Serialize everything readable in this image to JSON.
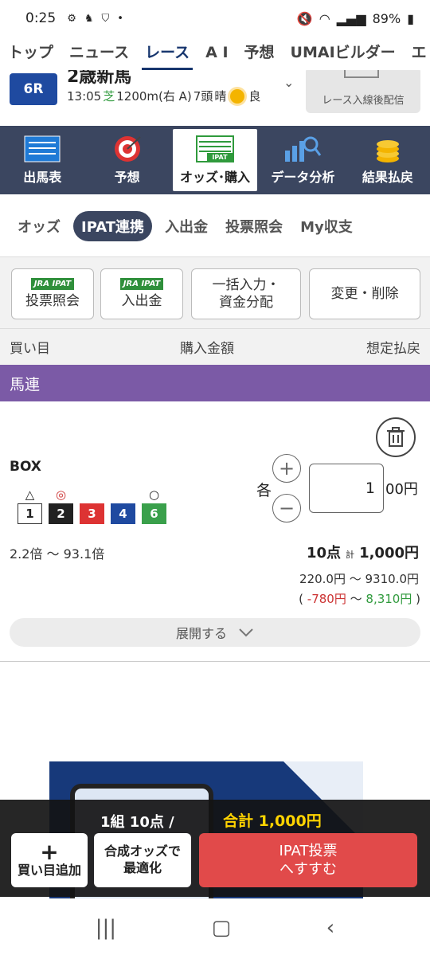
{
  "status": {
    "time": "0:25",
    "battery": "89%"
  },
  "topnav": {
    "items": [
      "トップ",
      "ニュース",
      "レース",
      "A I",
      "予想",
      "UMAIビルダー",
      "エ"
    ],
    "active_index": 2
  },
  "race": {
    "number": "6R",
    "name": "2歳新馬",
    "time": "13:05",
    "surface": "芝",
    "distance": "1200m(右 A)",
    "runners": "7頭",
    "weather": "晴",
    "track": "良",
    "replay_label": "レース入線後配信"
  },
  "menu": {
    "items": [
      {
        "label": "出馬表",
        "icon": "table-icon"
      },
      {
        "label": "予想",
        "icon": "target-icon"
      },
      {
        "label": "オッズ･購入",
        "icon": "ipat-icon"
      },
      {
        "label": "データ分析",
        "icon": "chart-search-icon"
      },
      {
        "label": "結果払戻",
        "icon": "coins-icon"
      }
    ],
    "active_index": 2
  },
  "subtabs": {
    "items": [
      "オッズ",
      "IPAT連携",
      "入出金",
      "投票照会",
      "My収支"
    ],
    "active_index": 1
  },
  "actions": {
    "jra_tag": "JRA IPAT",
    "vote_inquiry": "投票照会",
    "deposit": "入出金",
    "bulk_line1": "一括入力・",
    "bulk_line2": "資金分配",
    "modify": "変更・削除"
  },
  "columns": {
    "bet": "買い目",
    "amount": "購入金額",
    "payout": "想定払戻"
  },
  "bet_type": "馬連",
  "bet": {
    "mode": "BOX",
    "horses": [
      {
        "mark": "△",
        "number": "1"
      },
      {
        "mark": "◎",
        "number": "2"
      },
      {
        "mark": "",
        "number": "3"
      },
      {
        "mark": "",
        "number": "4"
      },
      {
        "mark": "○",
        "number": "6"
      }
    ],
    "each_label": "各",
    "amount_value": "1",
    "amount_suffix": "00円",
    "odds_range": "2.2倍 〜 93.1倍",
    "points": "10点",
    "total_small": "計",
    "total": "1,000円",
    "payout_range": "220.0円 〜 9310.0円",
    "profit_open": "(",
    "profit_min": "-780円",
    "profit_sep": "〜",
    "profit_max": "8,310円",
    "profit_close": ")",
    "expand_label": "展開する"
  },
  "bottom": {
    "count": "1組 10点 /",
    "total": "合計 1,000円",
    "add_label": "買い目追加",
    "optimize_line1": "合成オッズで",
    "optimize_line2": "最適化",
    "ipat_line1": "IPAT投票",
    "ipat_line2": "へすすむ"
  }
}
